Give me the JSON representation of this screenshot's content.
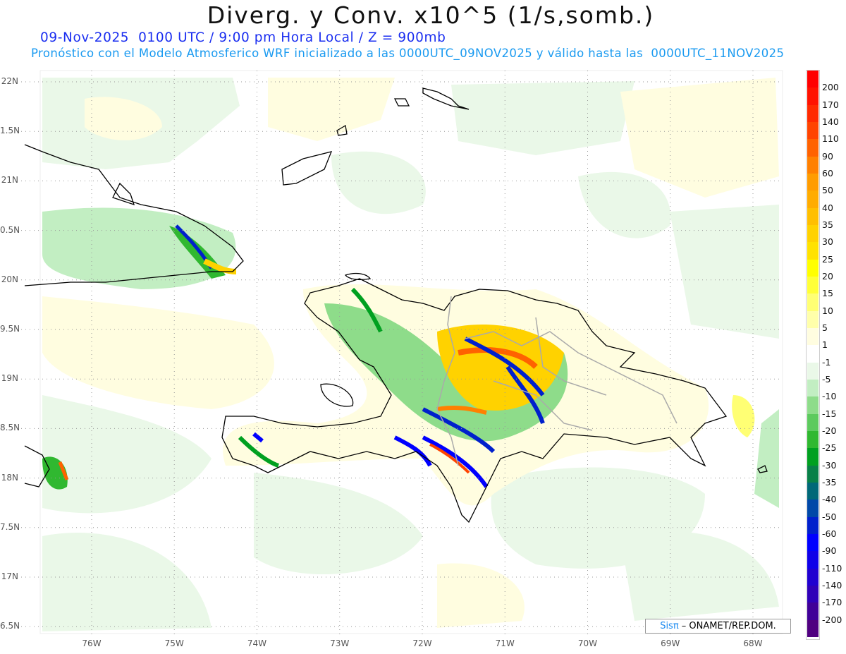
{
  "header": {
    "title": "Diverg. y Conv. x10^5 (1/s,somb.)",
    "subtitle": "09-Nov-2025  0100 UTC / 9:00 pm Hora Local / Z = 900mb",
    "description": "Pronóstico con el Modelo Atmosferico WRF inicializado a las 0000UTC_09NOV2025 y válido hasta las  0000UTC_11NOV2025"
  },
  "map": {
    "lat_labels": [
      "22N",
      "1.5N",
      "21N",
      "0.5N",
      "20N",
      "9.5N",
      "19N",
      "8.5N",
      "18N",
      "7.5N",
      "17N",
      "6.5N"
    ],
    "lon_labels": [
      "76W",
      "75W",
      "74W",
      "73W",
      "72W",
      "71W",
      "70W",
      "69W",
      "68W"
    ]
  },
  "colorbar": {
    "labels": [
      "200",
      "170",
      "140",
      "110",
      "90",
      "60",
      "50",
      "40",
      "35",
      "30",
      "25",
      "20",
      "15",
      "10",
      "5",
      "1",
      "-1",
      "-5",
      "-10",
      "-15",
      "-20",
      "-25",
      "-30",
      "-35",
      "-40",
      "-50",
      "-60",
      "-90",
      "-110",
      "-140",
      "-170",
      "-200"
    ],
    "colors": [
      "#ff0000",
      "#ff1200",
      "#ff2a00",
      "#ff4400",
      "#ff6200",
      "#ff8000",
      "#ff9c00",
      "#ffac00",
      "#ffbf00",
      "#ffd200",
      "#ffe200",
      "#ffff00",
      "#ffff38",
      "#ffff74",
      "#ffffaa",
      "#fffde0",
      "#ffffff",
      "#eaf8e8",
      "#c2eec2",
      "#8edc8a",
      "#5dca5e",
      "#30b830",
      "#00a020",
      "#088048",
      "#006878",
      "#0048a8",
      "#0020cc",
      "#0000ff",
      "#1000e8",
      "#2000d0",
      "#3000b8",
      "#400098",
      "#500080"
    ]
  },
  "credit": {
    "brand": "Sisπ",
    "text": " – ONAMET/REP.DOM."
  }
}
